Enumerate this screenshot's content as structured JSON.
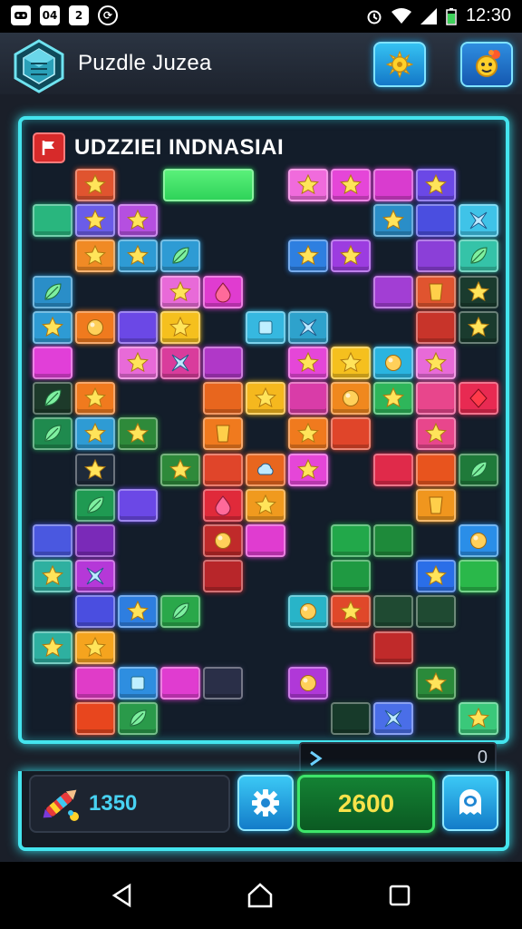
{
  "status_bar": {
    "icons": [
      "game-icon",
      "notification-04-icon",
      "photo-icon",
      "sync-icon"
    ],
    "left_labels": [
      "04",
      "2"
    ],
    "time": "12:30"
  },
  "header": {
    "title": "Puzdle Juzea",
    "logo_icon": "crystal-cube-icon",
    "buttons": [
      "sun-gear-icon",
      "flower-badge-icon"
    ]
  },
  "board": {
    "title": "UDZZIEI INDNASIAI",
    "flag_icon": "flag-icon",
    "tiles": [
      {
        "r": 0,
        "c": 1,
        "color": "#e0542f",
        "sym": "star"
      },
      {
        "r": 0,
        "c": 6,
        "color": "#f06bdc",
        "sym": "star"
      },
      {
        "r": 0,
        "c": 7,
        "color": "#e546d8",
        "sym": "star"
      },
      {
        "r": 0,
        "c": 8,
        "color": "#d93ccf",
        "sym": "none"
      },
      {
        "r": 0,
        "c": 9,
        "color": "#6b48e6",
        "sym": "star"
      },
      {
        "r": 1,
        "c": 0,
        "color": "#29b67e",
        "sym": "none"
      },
      {
        "r": 1,
        "c": 1,
        "color": "#6a5ce8",
        "sym": "star"
      },
      {
        "r": 1,
        "c": 2,
        "color": "#b54fe0",
        "sym": "star"
      },
      {
        "r": 1,
        "c": 8,
        "color": "#2a8ec8",
        "sym": "star"
      },
      {
        "r": 1,
        "c": 9,
        "color": "#4a4ee0",
        "sym": "none"
      },
      {
        "r": 1,
        "c": 10,
        "color": "#3fc3e8",
        "sym": "cross"
      },
      {
        "r": 2,
        "c": 1,
        "color": "#f08a25",
        "sym": "star"
      },
      {
        "r": 2,
        "c": 2,
        "color": "#2e9bd4",
        "sym": "star"
      },
      {
        "r": 2,
        "c": 3,
        "color": "#2e9bd4",
        "sym": "leaf"
      },
      {
        "r": 2,
        "c": 6,
        "color": "#2e7fe0",
        "sym": "star"
      },
      {
        "r": 2,
        "c": 7,
        "color": "#9c3ce0",
        "sym": "star"
      },
      {
        "r": 2,
        "c": 9,
        "color": "#8b3fd8",
        "sym": "none"
      },
      {
        "r": 2,
        "c": 10,
        "color": "#35c3a8",
        "sym": "leaf"
      },
      {
        "r": 3,
        "c": 0,
        "color": "#2a8ec8",
        "sym": "leaf"
      },
      {
        "r": 3,
        "c": 3,
        "color": "#e86ad8",
        "sym": "star"
      },
      {
        "r": 3,
        "c": 4,
        "color": "#e03cd0",
        "sym": "drop"
      },
      {
        "r": 3,
        "c": 8,
        "color": "#a23ed4",
        "sym": "none"
      },
      {
        "r": 3,
        "c": 9,
        "color": "#e0542f",
        "sym": "shield"
      },
      {
        "r": 3,
        "c": 10,
        "color": "#1a3b2e",
        "sym": "star"
      },
      {
        "r": 4,
        "c": 0,
        "color": "#2e9bd4",
        "sym": "star"
      },
      {
        "r": 4,
        "c": 1,
        "color": "#f07a1e",
        "sym": "circle"
      },
      {
        "r": 4,
        "c": 2,
        "color": "#6b48e6",
        "sym": "none"
      },
      {
        "r": 4,
        "c": 3,
        "color": "#f5c01e",
        "sym": "star"
      },
      {
        "r": 4,
        "c": 5,
        "color": "#36b8e0",
        "sym": "square"
      },
      {
        "r": 4,
        "c": 6,
        "color": "#2ea2cc",
        "sym": "cross"
      },
      {
        "r": 4,
        "c": 9,
        "color": "#c8342a",
        "sym": "none"
      },
      {
        "r": 4,
        "c": 10,
        "color": "#1a3b2e",
        "sym": "star"
      },
      {
        "r": 5,
        "c": 0,
        "color": "#e13fd8",
        "sym": "none"
      },
      {
        "r": 5,
        "c": 2,
        "color": "#e86ad8",
        "sym": "star"
      },
      {
        "r": 5,
        "c": 3,
        "color": "#d93c9c",
        "sym": "cross"
      },
      {
        "r": 5,
        "c": 4,
        "color": "#b038c8",
        "sym": "none"
      },
      {
        "r": 5,
        "c": 6,
        "color": "#e546d8",
        "sym": "star"
      },
      {
        "r": 5,
        "c": 7,
        "color": "#f5c01e",
        "sym": "star"
      },
      {
        "r": 5,
        "c": 8,
        "color": "#2ab4e0",
        "sym": "circle"
      },
      {
        "r": 5,
        "c": 9,
        "color": "#e86ad8",
        "sym": "star"
      },
      {
        "r": 6,
        "c": 0,
        "color": "#1d3a2a",
        "sym": "leaf"
      },
      {
        "r": 6,
        "c": 1,
        "color": "#f07a1e",
        "sym": "star"
      },
      {
        "r": 6,
        "c": 4,
        "color": "#e8661e",
        "sym": "none"
      },
      {
        "r": 6,
        "c": 5,
        "color": "#f5b81e",
        "sym": "star"
      },
      {
        "r": 6,
        "c": 6,
        "color": "#d93ca8",
        "sym": "none"
      },
      {
        "r": 6,
        "c": 7,
        "color": "#f0881e",
        "sym": "circle"
      },
      {
        "r": 6,
        "c": 8,
        "color": "#2eb65a",
        "sym": "star"
      },
      {
        "r": 6,
        "c": 9,
        "color": "#e8468c",
        "sym": "none"
      },
      {
        "r": 6,
        "c": 10,
        "color": "#e82a52",
        "sym": "diamond"
      },
      {
        "r": 7,
        "c": 0,
        "color": "#1f8a4e",
        "sym": "leaf"
      },
      {
        "r": 7,
        "c": 1,
        "color": "#2e9bd4",
        "sym": "star"
      },
      {
        "r": 7,
        "c": 2,
        "color": "#2e8a3a",
        "sym": "star"
      },
      {
        "r": 7,
        "c": 4,
        "color": "#f07a1e",
        "sym": "shield"
      },
      {
        "r": 7,
        "c": 6,
        "color": "#f07a1e",
        "sym": "star"
      },
      {
        "r": 7,
        "c": 7,
        "color": "#e0452a",
        "sym": "none"
      },
      {
        "r": 7,
        "c": 9,
        "color": "#e8468c",
        "sym": "star"
      },
      {
        "r": 8,
        "c": 1,
        "color": "#1e2a3a",
        "sym": "star"
      },
      {
        "r": 8,
        "c": 3,
        "color": "#2e8a3a",
        "sym": "star"
      },
      {
        "r": 8,
        "c": 4,
        "color": "#e0452a",
        "sym": "none"
      },
      {
        "r": 8,
        "c": 5,
        "color": "#e8661e",
        "sym": "cloud"
      },
      {
        "r": 8,
        "c": 6,
        "color": "#e546d8",
        "sym": "star"
      },
      {
        "r": 8,
        "c": 8,
        "color": "#e02a4a",
        "sym": "none"
      },
      {
        "r": 8,
        "c": 9,
        "color": "#e8541e",
        "sym": "none"
      },
      {
        "r": 8,
        "c": 10,
        "color": "#1f7a3a",
        "sym": "leaf"
      },
      {
        "r": 9,
        "c": 1,
        "color": "#1f9a52",
        "sym": "leaf"
      },
      {
        "r": 9,
        "c": 2,
        "color": "#6b48e6",
        "sym": "none"
      },
      {
        "r": 9,
        "c": 4,
        "color": "#e02a3a",
        "sym": "drop"
      },
      {
        "r": 9,
        "c": 5,
        "color": "#f09a1e",
        "sym": "star"
      },
      {
        "r": 9,
        "c": 9,
        "color": "#f0961e",
        "sym": "shield"
      },
      {
        "r": 10,
        "c": 0,
        "color": "#4a58e0",
        "sym": "none"
      },
      {
        "r": 10,
        "c": 1,
        "color": "#7a2ab8",
        "sym": "none"
      },
      {
        "r": 10,
        "c": 4,
        "color": "#c02a2a",
        "sym": "circle"
      },
      {
        "r": 10,
        "c": 5,
        "color": "#e03cd0",
        "sym": "none"
      },
      {
        "r": 10,
        "c": 7,
        "color": "#22a84a",
        "sym": "none"
      },
      {
        "r": 10,
        "c": 8,
        "color": "#1e8a3a",
        "sym": "none"
      },
      {
        "r": 10,
        "c": 10,
        "color": "#2a8ee8",
        "sym": "circle"
      },
      {
        "r": 11,
        "c": 0,
        "color": "#2eb0a0",
        "sym": "star"
      },
      {
        "r": 11,
        "c": 1,
        "color": "#b538d8",
        "sym": "cross"
      },
      {
        "r": 11,
        "c": 4,
        "color": "#b8262a",
        "sym": "none"
      },
      {
        "r": 11,
        "c": 7,
        "color": "#1f9a42",
        "sym": "none"
      },
      {
        "r": 11,
        "c": 9,
        "color": "#2a6ee8",
        "sym": "star"
      },
      {
        "r": 11,
        "c": 10,
        "color": "#2ab84a",
        "sym": "none"
      },
      {
        "r": 12,
        "c": 1,
        "color": "#4a4ee0",
        "sym": "none"
      },
      {
        "r": 12,
        "c": 2,
        "color": "#2e7ee0",
        "sym": "star"
      },
      {
        "r": 12,
        "c": 3,
        "color": "#2aa84a",
        "sym": "leaf"
      },
      {
        "r": 12,
        "c": 6,
        "color": "#28b4c8",
        "sym": "circle"
      },
      {
        "r": 12,
        "c": 7,
        "color": "#e0482a",
        "sym": "star"
      },
      {
        "r": 12,
        "c": 8,
        "color": "#1f4a32",
        "sym": "none"
      },
      {
        "r": 12,
        "c": 9,
        "color": "#1f4a32",
        "sym": "none"
      },
      {
        "r": 13,
        "c": 0,
        "color": "#2eb0a0",
        "sym": "star"
      },
      {
        "r": 13,
        "c": 1,
        "color": "#f5a41e",
        "sym": "star"
      },
      {
        "r": 13,
        "c": 8,
        "color": "#c02a2a",
        "sym": "none"
      },
      {
        "r": 14,
        "c": 1,
        "color": "#e03cc8",
        "sym": "none"
      },
      {
        "r": 14,
        "c": 2,
        "color": "#2e8ee0",
        "sym": "square"
      },
      {
        "r": 14,
        "c": 3,
        "color": "#e03cd0",
        "sym": "none"
      },
      {
        "r": 14,
        "c": 4,
        "color": "#2a2f48",
        "sym": "none"
      },
      {
        "r": 14,
        "c": 6,
        "color": "#b038d8",
        "sym": "circle"
      },
      {
        "r": 14,
        "c": 9,
        "color": "#2a8a3a",
        "sym": "star"
      },
      {
        "r": 15,
        "c": 1,
        "color": "#e8461e",
        "sym": "none"
      },
      {
        "r": 15,
        "c": 2,
        "color": "#2a9a4a",
        "sym": "leaf"
      },
      {
        "r": 15,
        "c": 7,
        "color": "#173a2a",
        "sym": "none"
      },
      {
        "r": 15,
        "c": 8,
        "color": "#4a6ee8",
        "sym": "cross"
      },
      {
        "r": 15,
        "c": 10,
        "color": "#3ac87a",
        "sym": "star"
      }
    ]
  },
  "progress_bar": {
    "fraction": 0.54,
    "color": "#2fd35a"
  },
  "bottom_bar": {
    "arrow_icon": "play-arrow-icon",
    "counter": "0"
  },
  "footer": {
    "score_icon": "rocket-pencil-icon",
    "score": "1350",
    "settings_icon": "gear-icon",
    "points": "2600",
    "profile_icon": "ghost-icon"
  },
  "nav_bar": {
    "icons": [
      "back-triangle-icon",
      "home-icon",
      "recents-square-icon"
    ]
  }
}
